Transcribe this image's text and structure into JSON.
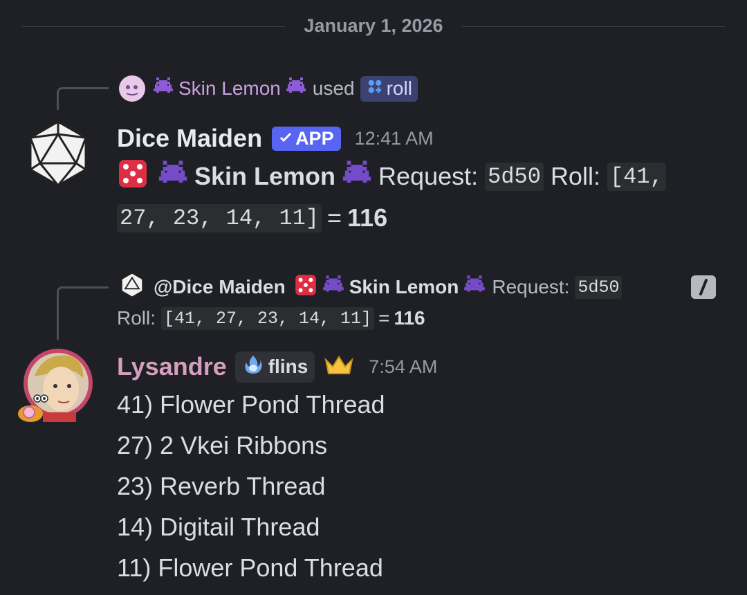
{
  "date_divider": "January 1, 2026",
  "message1": {
    "reply": {
      "user_prefix_icon": "purple-invader-icon",
      "user": "Skin Lemon",
      "used_text": "used",
      "command": "roll",
      "command_icon": "slash-command-icon"
    },
    "author": "Dice Maiden",
    "app_badge": "APP",
    "time": "12:41 AM",
    "content": {
      "dice_icon": "dice-icon",
      "user": "Skin Lemon",
      "request_label": "Request:",
      "request_value": "5d50",
      "roll_label": "Roll:",
      "roll_values_line1": "[41,",
      "roll_values_line2": "27, 23, 14, 11]",
      "equals": "=",
      "total": "116"
    }
  },
  "message2": {
    "reply": {
      "mention": "@Dice Maiden",
      "user": "Skin Lemon",
      "request_label": "Request:",
      "request_value": "5d50",
      "roll_label": "Roll:",
      "roll_values": "[41, 27, 23, 14, 11]",
      "equals": "=",
      "total": "116"
    },
    "author": "Lysandre",
    "tag": "flins",
    "time": "7:54 AM",
    "lines": [
      "41) Flower Pond Thread",
      "27) 2 Vkei Ribbons",
      "23) Reverb Thread",
      "14) Digitail Thread",
      "11) Flower Pond Thread"
    ]
  },
  "colors": {
    "background": "#1f2025",
    "app_badge": "#5865f2",
    "lysandre_name": "#d59fbf",
    "skin_lemon_name": "#c8a2e0"
  }
}
